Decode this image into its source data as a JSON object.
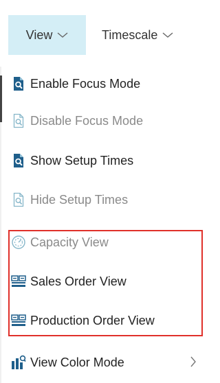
{
  "toolbar": {
    "view_label": "View",
    "timescale_label": "Timescale"
  },
  "menu": {
    "items": [
      {
        "label": "Enable Focus Mode",
        "icon": "focus-document-icon",
        "enabled": true
      },
      {
        "label": "Disable Focus Mode",
        "icon": "focus-document-outline-icon",
        "enabled": false
      },
      {
        "label": "Show Setup Times",
        "icon": "focus-document-icon",
        "enabled": true
      },
      {
        "label": "Hide Setup Times",
        "icon": "focus-document-outline-icon",
        "enabled": false
      },
      {
        "label": "Capacity View",
        "icon": "capacity-gauge-icon",
        "enabled": false
      },
      {
        "label": "Sales Order View",
        "icon": "order-grid-icon",
        "enabled": true
      },
      {
        "label": "Production Order View",
        "icon": "order-grid-icon",
        "enabled": true
      },
      {
        "label": "View Color Mode",
        "icon": "color-mode-icon",
        "enabled": true,
        "has_submenu": true
      }
    ]
  },
  "colors": {
    "active_tab_bg": "#d4eef6",
    "icon_blue": "#1f5f8b",
    "icon_disabled": "#86b6c9",
    "highlight_border": "#e0302a"
  }
}
